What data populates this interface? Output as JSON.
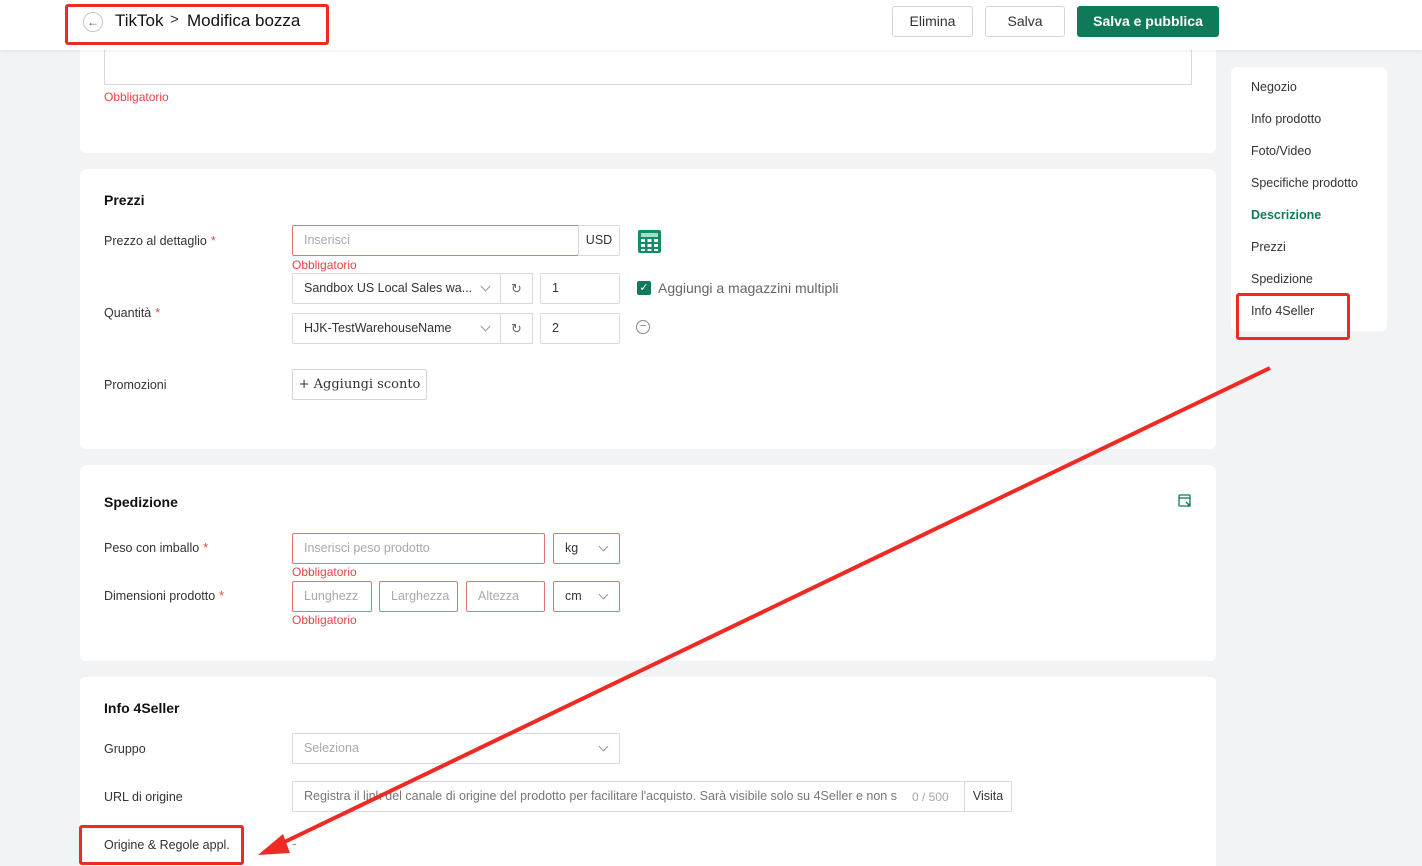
{
  "header": {
    "back_icon": "arrow-left-icon",
    "crumb_app": "TikTok",
    "crumb_separator": ">",
    "crumb_page": "Modifica bozza",
    "delete_label": "Elimina",
    "save_label": "Salva",
    "publish_label": "Salva e pubblica"
  },
  "top_card": {
    "required_msg": "Obbligatorio"
  },
  "prices": {
    "title": "Prezzi",
    "retail_label": "Prezzo al dettaglio",
    "retail_placeholder": "Inserisci",
    "currency": "USD",
    "required_msg": "Obbligatorio",
    "quantity_label": "Quantità",
    "warehouses": [
      {
        "name": "Sandbox US Local Sales wa...",
        "qty": "1"
      },
      {
        "name": "HJK-TestWarehouseName",
        "qty": "2"
      }
    ],
    "multi_warehouse_label": "Aggiungi a magazzini multipli",
    "promotions_label": "Promozioni",
    "add_discount_label": "+ Aggiungi sconto"
  },
  "shipping": {
    "title": "Spedizione",
    "weight_label": "Peso con imballo",
    "weight_placeholder": "Inserisci peso prodotto",
    "weight_unit": "kg",
    "required_msg": "Obbligatorio",
    "dims_label": "Dimensioni prodotto",
    "length_placeholder": "Lunghezz",
    "width_placeholder": "Larghezza",
    "height_placeholder": "Altezza",
    "dims_unit": "cm",
    "required_msg2": "Obbligatorio"
  },
  "info4seller": {
    "title": "Info 4Seller",
    "group_label": "Gruppo",
    "group_placeholder": "Seleziona",
    "url_label": "URL di origine",
    "url_placeholder": "Registra il link del canale di origine del prodotto per facilitare l'acquisto. Sarà visibile solo su 4Seller e non s",
    "url_counter": "0 / 500",
    "visit_label": "Visita",
    "origin_label": "Origine & Regole appl.",
    "origin_value": "-"
  },
  "sidenav": {
    "items": [
      "Negozio",
      "Info prodotto",
      "Foto/Video",
      "Specifiche prodotto",
      "Descrizione",
      "Prezzi",
      "Spedizione",
      "Info 4Seller"
    ],
    "active": "Descrizione"
  },
  "colors": {
    "accent": "#0f7a5a",
    "error": "#e54545",
    "annotation": "#ee2a24"
  }
}
